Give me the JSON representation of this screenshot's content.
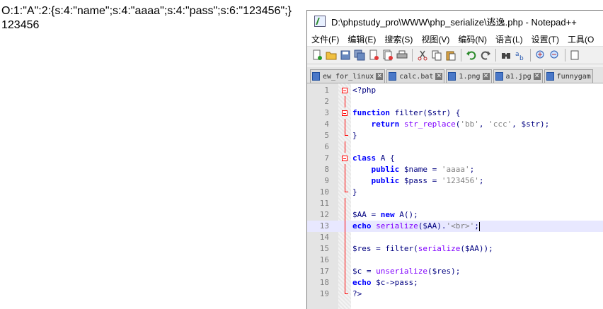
{
  "browser": {
    "line1": "O:1:\"A\":2:{s:4:\"name\";s:4:\"aaaa\";s:4:\"pass\";s:6:\"123456\";}",
    "line2": "123456"
  },
  "window": {
    "title": "D:\\phpstudy_pro\\WWW\\php_serialize\\逃逸.php - Notepad++"
  },
  "menu": [
    "文件(F)",
    "编辑(E)",
    "搜索(S)",
    "视图(V)",
    "编码(N)",
    "语言(L)",
    "设置(T)",
    "工具(O"
  ],
  "toolbar_icons": [
    "new-file-icon",
    "open-file-icon",
    "save-icon",
    "save-all-icon",
    "close-icon",
    "close-all-icon",
    "print-icon",
    "cut-icon",
    "copy-icon",
    "paste-icon",
    "undo-icon",
    "redo-icon",
    "find-icon",
    "replace-icon",
    "zoom-in-icon",
    "zoom-out-icon",
    "sync-icon"
  ],
  "tabs": [
    {
      "label": "ew_for_linux"
    },
    {
      "label": "calc.bat"
    },
    {
      "label": "1.png"
    },
    {
      "label": "a1.jpg"
    },
    {
      "label": "funnygam"
    }
  ],
  "editor": {
    "current_line": 13,
    "lines": [
      {
        "n": "1",
        "text": "<?php"
      },
      {
        "n": "2",
        "text": ""
      },
      {
        "n": "3",
        "text": "function filter($str) {"
      },
      {
        "n": "4",
        "text": "    return str_replace('bb', 'ccc', $str);"
      },
      {
        "n": "5",
        "text": "}"
      },
      {
        "n": "6",
        "text": ""
      },
      {
        "n": "7",
        "text": "class A {"
      },
      {
        "n": "8",
        "text": "    public $name = 'aaaa';"
      },
      {
        "n": "9",
        "text": "    public $pass = '123456';"
      },
      {
        "n": "10",
        "text": "}"
      },
      {
        "n": "11",
        "text": ""
      },
      {
        "n": "12",
        "text": "$AA = new A();"
      },
      {
        "n": "13",
        "text": "echo serialize($AA).'<br>';"
      },
      {
        "n": "14",
        "text": ""
      },
      {
        "n": "15",
        "text": "$res = filter(serialize($AA));"
      },
      {
        "n": "16",
        "text": ""
      },
      {
        "n": "17",
        "text": "$c = unserialize($res);"
      },
      {
        "n": "18",
        "text": "echo $c->pass;"
      },
      {
        "n": "19",
        "text": "?>"
      }
    ]
  },
  "colors": {
    "keyword": "#0000ff",
    "variable": "#000080",
    "string": "#808080",
    "php_tag": "#ff0000",
    "current_line": "#e8e8ff"
  }
}
